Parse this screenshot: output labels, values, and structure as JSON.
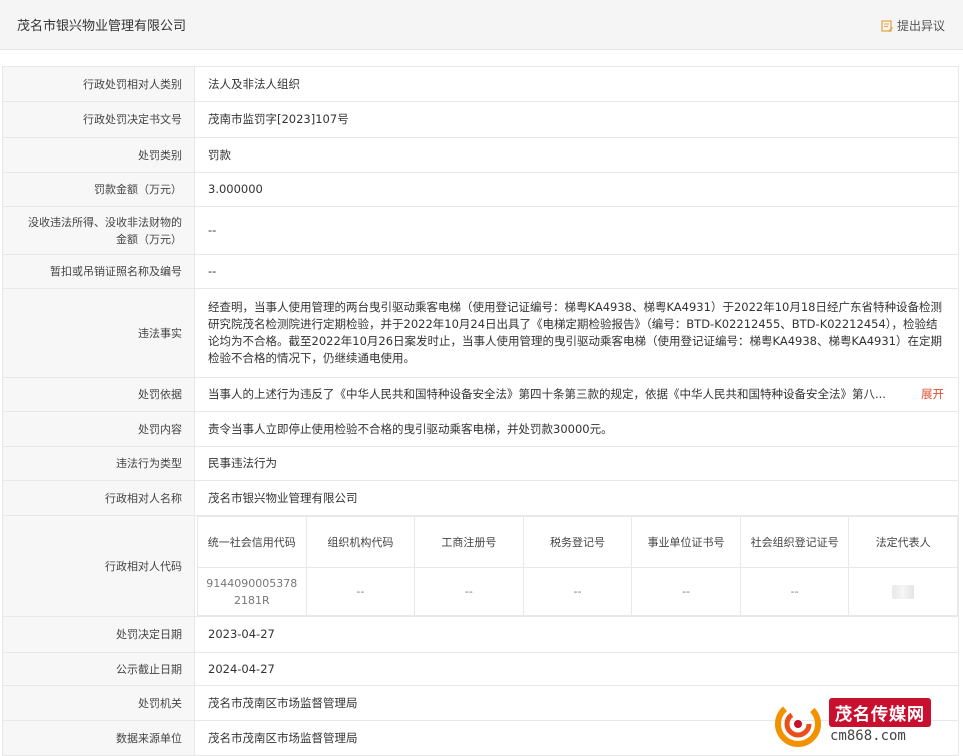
{
  "header": {
    "title": "茂名市银兴物业管理有限公司",
    "objection_label": "提出异议"
  },
  "rows": {
    "r0": {
      "label": "行政处罚相对人类别",
      "value": "法人及非法人组织"
    },
    "r1": {
      "label": "行政处罚决定书文号",
      "value": "茂南市监罚字[2023]107号"
    },
    "r2": {
      "label": "处罚类别",
      "value": "罚款"
    },
    "r3": {
      "label": "罚款金额（万元）",
      "value": "3.000000"
    },
    "r4": {
      "label_line1": "没收违法所得、没收非法财物的",
      "label_line2": "金额（万元）",
      "value": "--"
    },
    "r5": {
      "label": "暂扣或吊销证照名称及编号",
      "value": "--"
    },
    "r6": {
      "label": "违法事实",
      "value": "经查明，当事人使用管理的两台曳引驱动乘客电梯（使用登记证编号：梯粤KA4938、梯粤KA4931）于2022年10月18日经广东省特种设备检测研究院茂名检测院进行定期检验，并于2022年10月24日出具了《电梯定期检验报告》（编号：BTD-K02212455、BTD-K02212454），检验结论均为不合格。截至2022年10月26日案发时止，当事人使用管理的曳引驱动乘客电梯（使用登记证编号：梯粤KA4938、梯粤KA4931）在定期检验不合格的情况下，仍继续通电使用。"
    },
    "r7": {
      "label": "处罚依据",
      "value": "当事人的上述行为违反了《中华人民共和国特种设备安全法》第四十条第三款的规定，依据《中华人民共和国特种设备安全法》第八...",
      "more": "展开"
    },
    "r8": {
      "label": "处罚内容",
      "value": "责令当事人立即停止使用检验不合格的曳引驱动乘客电梯，并处罚款30000元。"
    },
    "r9": {
      "label": "违法行为类型",
      "value": "民事违法行为"
    },
    "r10": {
      "label": "行政相对人名称",
      "value": "茂名市银兴物业管理有限公司"
    },
    "r11": {
      "label": "行政相对人代码"
    },
    "r12": {
      "label": "处罚决定日期",
      "value": "2023-04-27"
    },
    "r13": {
      "label": "公示截止日期",
      "value": "2024-04-27"
    },
    "r14": {
      "label": "处罚机关",
      "value": "茂名市茂南区市场监督管理局"
    },
    "r15": {
      "label": "数据来源单位",
      "value": "茂名市茂南区市场监督管理局"
    }
  },
  "codes_table": {
    "headers": [
      "统一社会信用代码",
      "组织机构代码",
      "工商注册号",
      "税务登记号",
      "事业单位证书号",
      "社会组织登记证号",
      "法定代表人"
    ],
    "values": [
      "91440900053782181R",
      "--",
      "--",
      "--",
      "--",
      "--",
      ""
    ]
  },
  "watermark": {
    "brand": "茂名传媒网",
    "url": "cm868.com"
  },
  "colors": {
    "accent_link": "#e34c33",
    "label_bg": "#f7f7f7",
    "border": "#e8e8e8",
    "brand_red": "#c8102e"
  }
}
